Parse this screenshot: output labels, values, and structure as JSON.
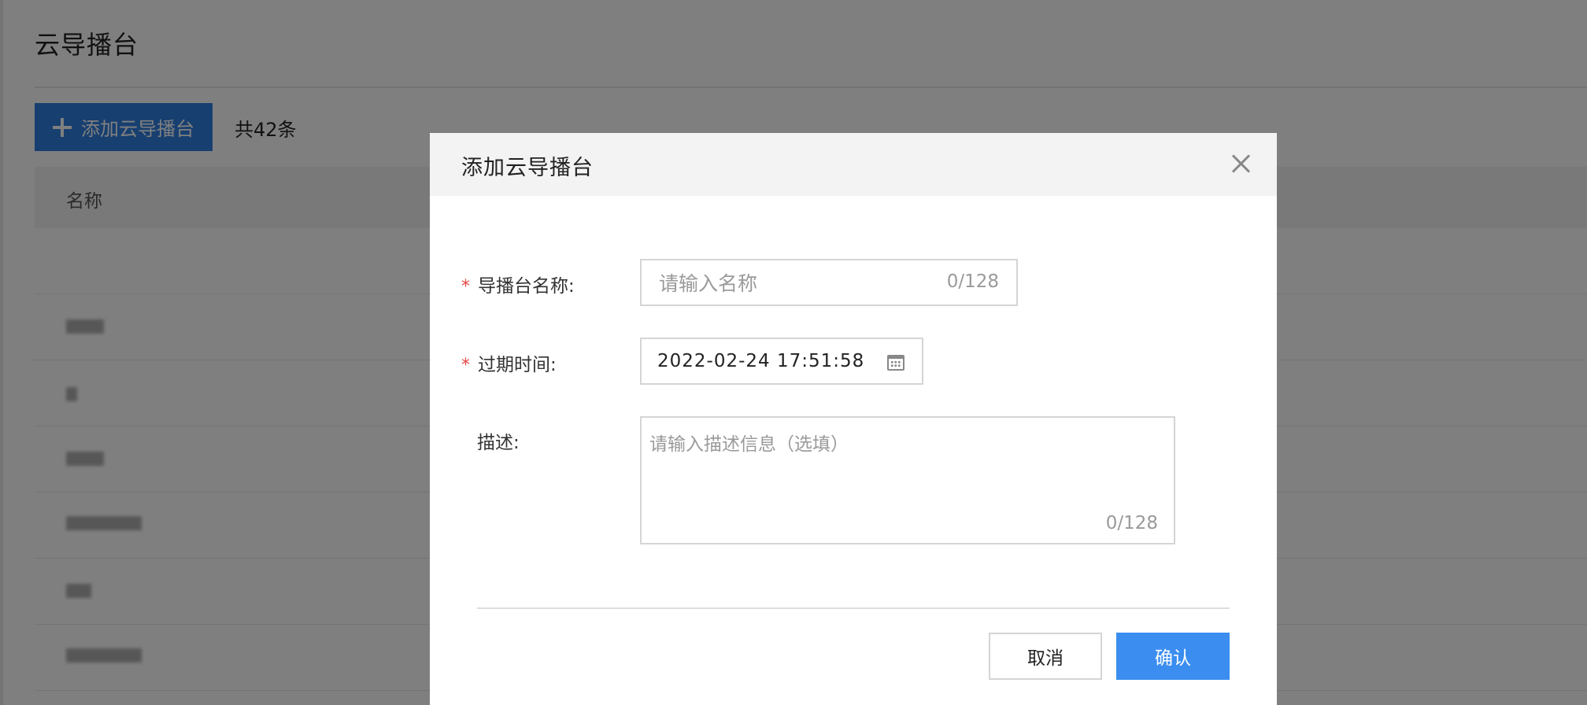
{
  "page": {
    "title": "云导播台",
    "add_button_label": "添加云导播台",
    "total_label": "共42条",
    "table": {
      "columns": [
        "名称"
      ]
    }
  },
  "modal": {
    "title": "添加云导播台",
    "fields": {
      "name": {
        "label": "导播台名称:",
        "required_mark": "*",
        "placeholder": "请输入名称",
        "counter": "0/128"
      },
      "expiry": {
        "label": "过期时间:",
        "required_mark": "*",
        "value": "2022-02-24 17:51:58"
      },
      "description": {
        "label": "描述:",
        "placeholder": "请输入描述信息（选填）",
        "counter": "0/128"
      }
    },
    "buttons": {
      "cancel": "取消",
      "confirm": "确认"
    }
  },
  "colors": {
    "primary": "#2e7fe0",
    "confirm": "#3b8ef0",
    "required": "#e54545"
  },
  "icons": [
    "plus-icon",
    "close-icon",
    "calendar-icon"
  ]
}
